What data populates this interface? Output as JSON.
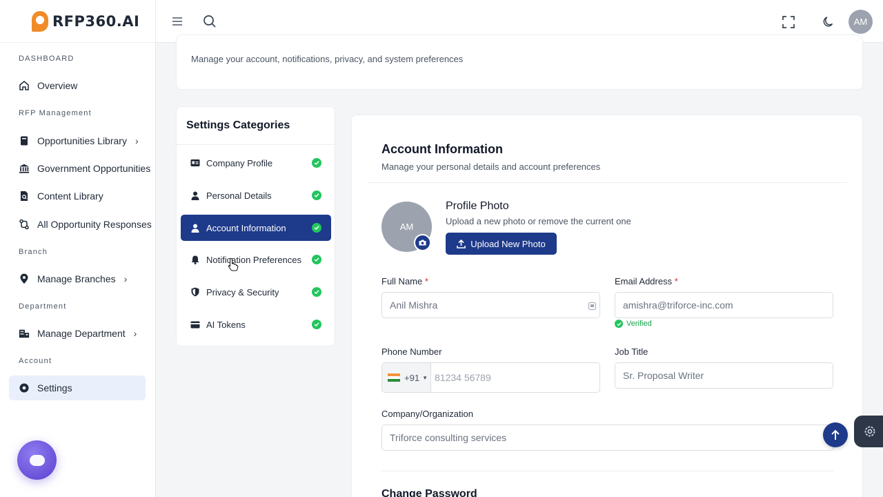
{
  "app": {
    "logo_text": "RFP360.AI",
    "user_initials": "AM"
  },
  "sidebar": {
    "sections": {
      "dashboard": "DASHBOARD",
      "rfp": "RFP Management",
      "branch": "Branch",
      "department": "Department",
      "account": "Account"
    },
    "items": {
      "overview": "Overview",
      "opportunities_library": "Opportunities Library",
      "government_opportunities": "Government Opportunities",
      "content_library": "Content Library",
      "all_opportunity_responses": "All Opportunity Responses",
      "manage_branches": "Manage Branches",
      "manage_department": "Manage Department",
      "settings": "Settings"
    }
  },
  "header": {
    "subtitle": "Manage your account, notifications, privacy, and system preferences"
  },
  "categories": {
    "title": "Settings Categories",
    "items": [
      {
        "label": "Company Profile",
        "completed": true
      },
      {
        "label": "Personal Details",
        "completed": true
      },
      {
        "label": "Account Information",
        "completed": true,
        "active": true
      },
      {
        "label": "Notification Preferences",
        "completed": true
      },
      {
        "label": "Privacy & Security",
        "completed": true
      },
      {
        "label": "AI Tokens",
        "completed": true
      }
    ]
  },
  "account": {
    "title": "Account Information",
    "subtitle": "Manage your personal details and account preferences",
    "avatar_initials": "AM",
    "profile_photo": {
      "title": "Profile Photo",
      "subtitle": "Upload a new photo or remove the current one",
      "upload_label": "Upload New Photo"
    },
    "fields": {
      "full_name": {
        "label": "Full Name",
        "required": "*",
        "value": "Anil Mishra"
      },
      "email": {
        "label": "Email Address",
        "required": "*",
        "value": "amishra@triforce-inc.com",
        "status": "Verified"
      },
      "phone": {
        "label": "Phone Number",
        "country_code": "+91",
        "placeholder": "81234 56789"
      },
      "job_title": {
        "label": "Job Title",
        "value": "Sr. Proposal Writer"
      },
      "company": {
        "label": "Company/Organization",
        "value": "Triforce consulting services"
      }
    },
    "change_password_title": "Change Password"
  },
  "colors": {
    "primary": "#1e3a8a",
    "success": "#22c55e",
    "brand_orange": "#f08c2a"
  }
}
